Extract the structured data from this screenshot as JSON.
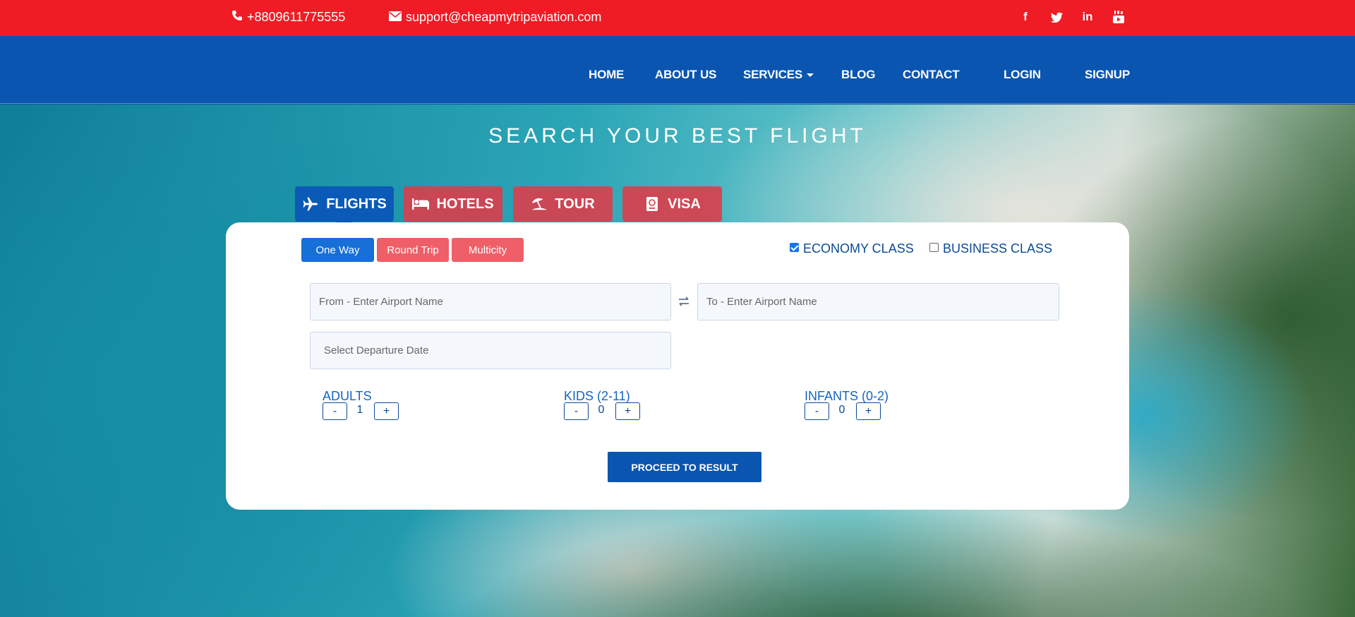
{
  "topbar": {
    "phone": "+8809611775555",
    "email": "support@cheapmytripaviation.com",
    "social": [
      {
        "icon": "facebook-icon",
        "glyph": "f"
      },
      {
        "icon": "twitter-icon",
        "glyph": "t"
      },
      {
        "icon": "linkedin-icon",
        "glyph": "in"
      },
      {
        "icon": "youtube-icon",
        "glyph": "▶"
      }
    ],
    "bg_color": "#ef1b25"
  },
  "nav": {
    "home": "HOME",
    "about": "ABOUT US",
    "services": "SERVICES",
    "blog": "BLOG",
    "contact": "CONTACT",
    "login": "LOGIN",
    "signup": "SIGNUP",
    "bg_color": "#0a55b0"
  },
  "hero": {
    "title": "SEARCH YOUR BEST FLIGHT"
  },
  "tabs": [
    {
      "label": "FLIGHTS",
      "icon": "plane-icon",
      "active": true
    },
    {
      "label": "HOTELS",
      "icon": "bed-icon",
      "active": false
    },
    {
      "label": "TOUR",
      "icon": "umbrella-beach-icon",
      "active": false
    },
    {
      "label": "VISA",
      "icon": "passport-icon",
      "active": false
    }
  ],
  "trip_types": {
    "one_way": "One Way",
    "round_trip": "Round Trip",
    "multicity": "Multicity",
    "selected": "One Way"
  },
  "classes": {
    "economy": "ECONOMY CLASS",
    "economy_checked": true,
    "business": "BUSINESS CLASS",
    "business_checked": false
  },
  "search": {
    "from_placeholder": "From - Enter Airport Name",
    "to_placeholder": "To - Enter Airport Name",
    "date_placeholder": "Select Departure Date"
  },
  "passengers": {
    "adults": {
      "label": "ADULTS",
      "count": "1"
    },
    "kids": {
      "label": "KIDS (2-11)",
      "count": "0"
    },
    "infants": {
      "label": "INFANTS (0-2)",
      "count": "0"
    },
    "minus": "-",
    "plus": "+"
  },
  "proceed_label": "PROCEED TO RESULT"
}
